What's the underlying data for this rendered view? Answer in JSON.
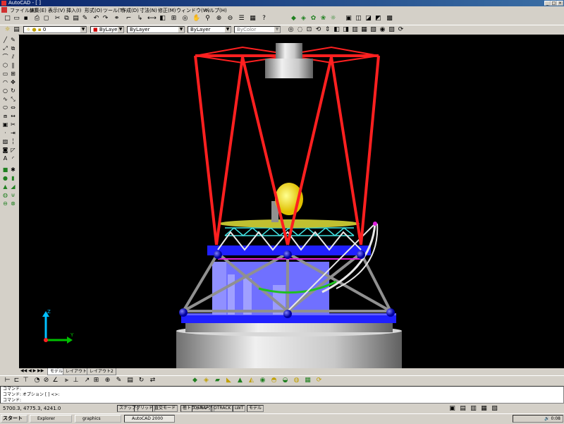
{
  "window": {
    "title": "AutoCAD - [ ]"
  },
  "menu": {
    "items": [
      "ファイル(F)",
      "編集(E)",
      "表示(V)",
      "挿入(I)",
      "形式(O)",
      "ツール(T)",
      "作成(D)",
      "寸法(N)",
      "修正(M)",
      "ウィンドウ(W)",
      "ヘルプ(H)"
    ]
  },
  "properties": {
    "layer": "0",
    "color": "ByLayer",
    "linetype": "ByLayer",
    "lineweight": "ByLayer",
    "plotstyle": "ByColor"
  },
  "layout_tabs": [
    "モデル",
    "レイアウト1",
    "レイアウト2"
  ],
  "command": {
    "lines": [
      "コマンド:",
      "コマンド: オプション [ ] <>:",
      "コマンド:"
    ]
  },
  "status": {
    "coords": "5700.3, 4775.3, 4241.0",
    "toggles": [
      "スナップ",
      "グリッド",
      "直交モード",
      "極トラッキング",
      "OSNAP",
      "OTRACK",
      "LWT",
      "モデル"
    ]
  },
  "taskbar": {
    "start": "スタート",
    "tasks": [
      "Explorer",
      "graphics",
      "AutoCAD 2000"
    ],
    "clock": "0:08"
  },
  "ucs": {
    "x": "Y",
    "z": "Z"
  },
  "colors": {
    "viewport": "#000000",
    "truss": "#ff2020",
    "deck": "#2030ff",
    "cyan": "#40e0e0"
  }
}
